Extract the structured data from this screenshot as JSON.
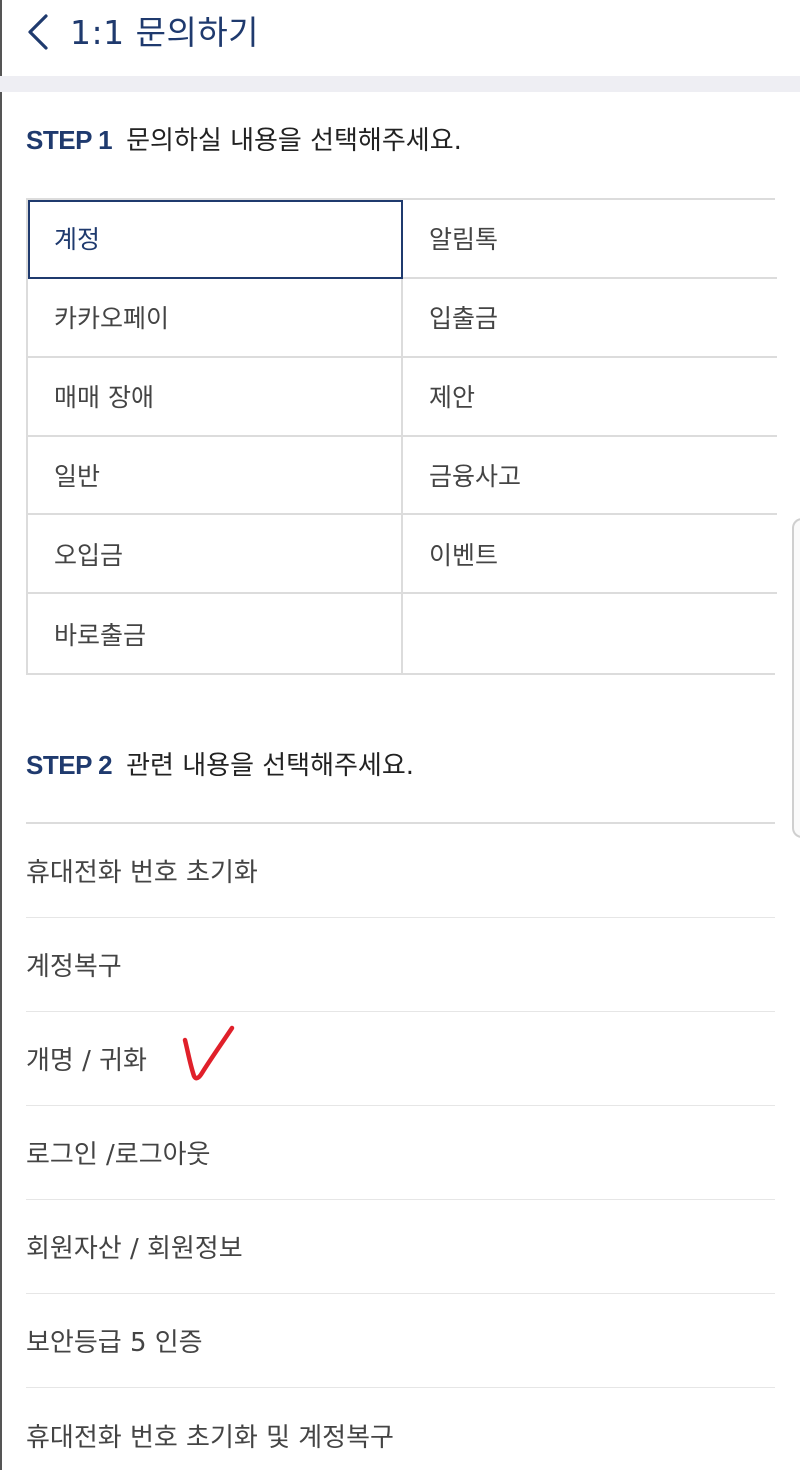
{
  "header": {
    "title": "1:1 문의하기"
  },
  "step1": {
    "label": "STEP 1",
    "text": "문의하실 내용을 선택해주세요."
  },
  "categories": [
    {
      "label": "계정",
      "selected": true
    },
    {
      "label": "알림톡"
    },
    {
      "label": "카카오페이"
    },
    {
      "label": "입출금"
    },
    {
      "label": "매매 장애"
    },
    {
      "label": "제안"
    },
    {
      "label": "일반"
    },
    {
      "label": "금융사고"
    },
    {
      "label": "오입금"
    },
    {
      "label": "이벤트"
    },
    {
      "label": "바로출금"
    },
    {
      "label": ""
    }
  ],
  "step2": {
    "label": "STEP 2",
    "text": "관련 내용을 선택해주세요."
  },
  "items": [
    {
      "label": "휴대전화 번호 초기화"
    },
    {
      "label": "계정복구"
    },
    {
      "label": "개명 / 귀화"
    },
    {
      "label": "로그인 /로그아웃"
    },
    {
      "label": "회원자산 / 회원정보"
    },
    {
      "label": "보안등급 5 인증"
    },
    {
      "label": "휴대전화 번호 초기화 및 계정복구"
    }
  ],
  "colors": {
    "accent": "#1f3a6e",
    "border": "#dcdcdc",
    "band": "#eeeef3",
    "annotation": "#e0202a"
  },
  "icons": {
    "back": "chevron-left-icon",
    "annotation": "check-mark-icon"
  }
}
